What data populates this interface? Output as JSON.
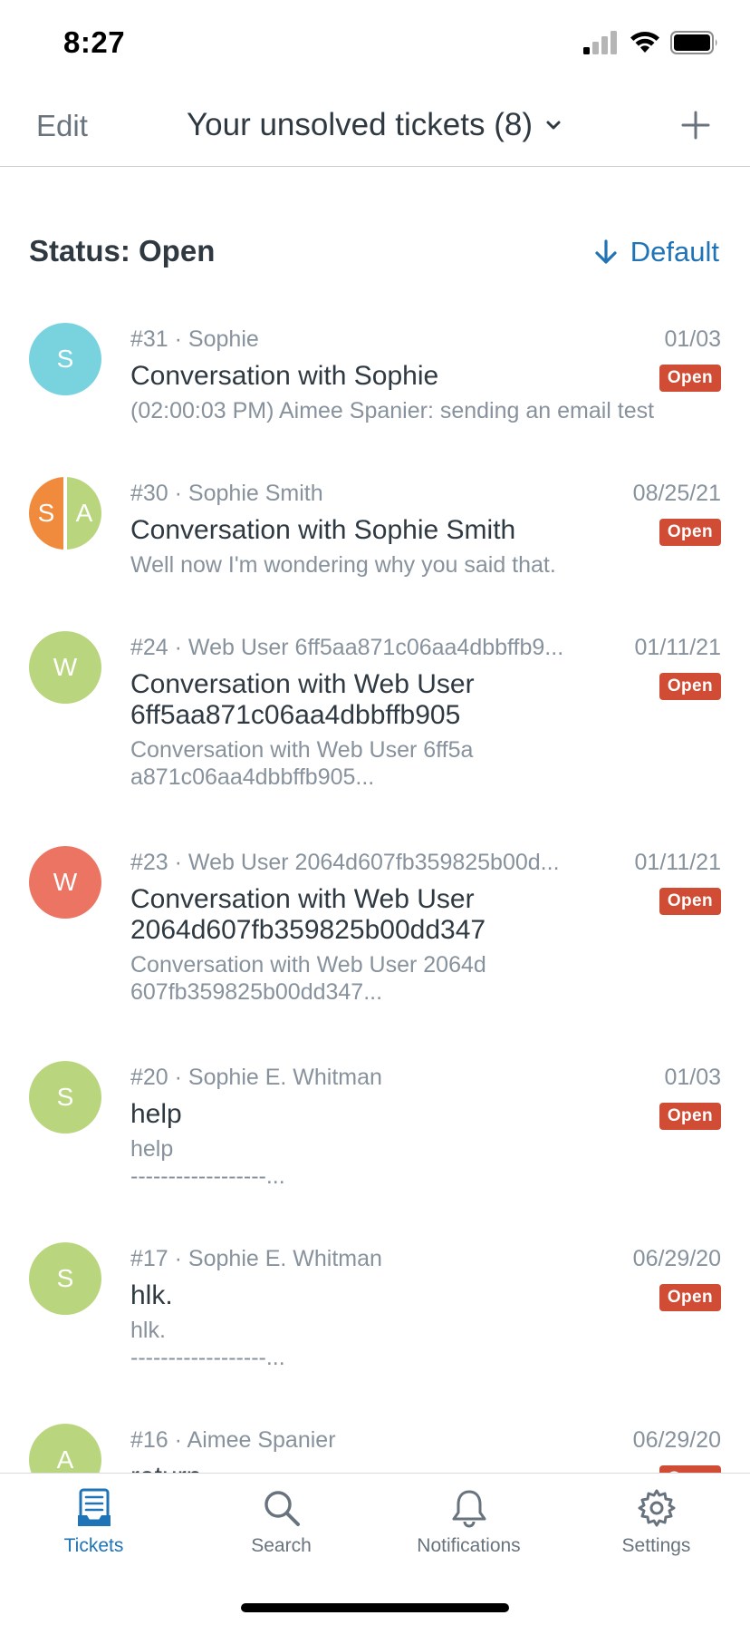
{
  "status_bar": {
    "time": "8:27"
  },
  "nav": {
    "edit_label": "Edit",
    "title": "Your unsolved tickets (8)"
  },
  "section": {
    "title": "Status: Open",
    "sort_label": "Default"
  },
  "tickets": [
    {
      "meta": "#31 · Sophie",
      "date": "01/03",
      "subject": "Conversation with Sophie",
      "preview": "(02:00:03 PM) Aimee Spanier: sending an email test",
      "badge": "Open",
      "avatar_letters": [
        "S"
      ],
      "avatar_colors": [
        "#78d3df"
      ]
    },
    {
      "meta": "#30 · Sophie Smith",
      "date": "08/25/21",
      "subject": "Conversation with Sophie Smith",
      "preview": "Well now I'm wondering why you said that.",
      "badge": "Open",
      "avatar_letters": [
        "S",
        "A"
      ],
      "avatar_colors": [
        "#f08a3c",
        "#b9d67e"
      ]
    },
    {
      "meta": "#24 · Web User 6ff5aa871c06aa4dbbffb9...",
      "date": "01/11/21",
      "subject": "Conversation with Web User 6ff5aa871c06aa4dbbffb905",
      "preview": "Conversation with Web User 6ff5aa871c06aa4dbbffb905...",
      "badge": "Open",
      "avatar_letters": [
        "W"
      ],
      "avatar_colors": [
        "#b9d67e"
      ]
    },
    {
      "meta": "#23 · Web User 2064d607fb359825b00d...",
      "date": "01/11/21",
      "subject": "Conversation with Web User 2064d607fb359825b00dd347",
      "preview": "Conversation with Web User 2064d607fb359825b00dd347...",
      "badge": "Open",
      "avatar_letters": [
        "W"
      ],
      "avatar_colors": [
        "#ec7463"
      ]
    },
    {
      "meta": "#20 · Sophie E. Whitman",
      "date": "01/03",
      "subject": "help",
      "preview": "help\n------------------...",
      "badge": "Open",
      "avatar_letters": [
        "S"
      ],
      "avatar_colors": [
        "#b9d67e"
      ]
    },
    {
      "meta": "#17 · Sophie E. Whitman",
      "date": "06/29/20",
      "subject": "hlk.",
      "preview": "hlk.\n------------------...",
      "badge": "Open",
      "avatar_letters": [
        "S"
      ],
      "avatar_colors": [
        "#b9d67e"
      ]
    },
    {
      "meta": "#16 · Aimee Spanier",
      "date": "06/29/20",
      "subject": "return",
      "preview": "",
      "badge": "Open",
      "avatar_letters": [
        "A"
      ],
      "avatar_colors": [
        "#b9d67e"
      ]
    }
  ],
  "tabs": [
    {
      "label": "Tickets",
      "icon": "tickets-icon",
      "active": true
    },
    {
      "label": "Search",
      "icon": "search-icon",
      "active": false
    },
    {
      "label": "Notifications",
      "icon": "bell-icon",
      "active": false
    },
    {
      "label": "Settings",
      "icon": "gear-icon",
      "active": false
    }
  ],
  "colors": {
    "accent": "#1f73b7",
    "badge_open": "#d04c35",
    "text_primary": "#2f3941",
    "text_secondary": "#87929d"
  }
}
